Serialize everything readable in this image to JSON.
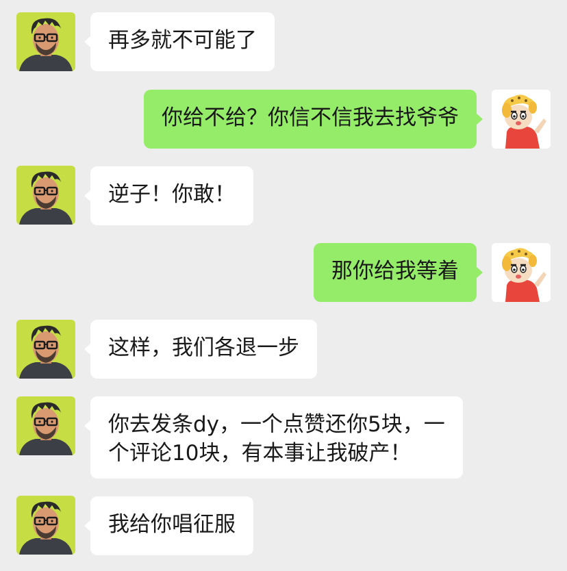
{
  "chat": {
    "background_color": "#ededed",
    "incoming_bubble_color": "#ffffff",
    "outgoing_bubble_color": "#95ec69",
    "incoming_avatar": "man-with-glasses-avatar",
    "outgoing_avatar": "cartoon-kid-avatar",
    "messages": [
      {
        "sender": "other",
        "text": "再多就不可能了"
      },
      {
        "sender": "me",
        "text": "你给不给？你信不信我去找爷爷"
      },
      {
        "sender": "other",
        "text": "逆子！你敢！"
      },
      {
        "sender": "me",
        "text": "那你给我等着"
      },
      {
        "sender": "other",
        "text": "这样，我们各退一步"
      },
      {
        "sender": "other",
        "text": "你去发条dy，一个点赞还你5块，一\n个评论10块，有本事让我破产！"
      },
      {
        "sender": "other",
        "text": "我给你唱征服"
      }
    ]
  }
}
